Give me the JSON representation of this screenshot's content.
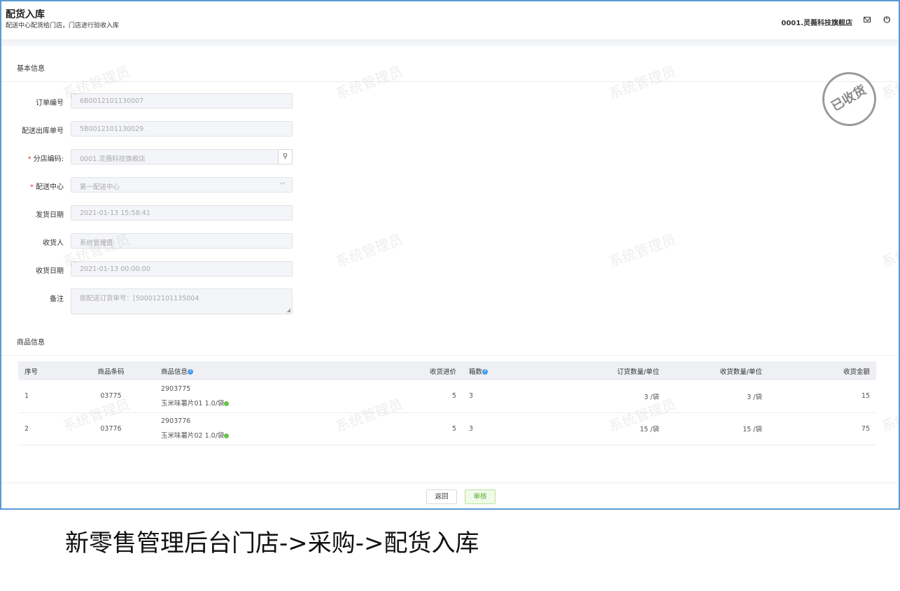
{
  "header": {
    "title": "配货入库",
    "subtitle": "配送中心配货给门店，门店进行验收入库",
    "store": "0001.灵薇科技旗舰店",
    "power_icon": "⏻"
  },
  "basic": {
    "section_title": "基本信息",
    "fields": [
      {
        "label": "订单编号",
        "value": "6B0012101130007"
      },
      {
        "label": "配送出库单号",
        "value": "5B0012101130029"
      },
      {
        "label": "分店编码:",
        "value": "0001.灵薇科技旗舰店",
        "required": "*"
      },
      {
        "label": "配送中心",
        "value": "第一配送中心",
        "required": "*"
      },
      {
        "label": "发货日期",
        "value": "2021-01-13 15:58:41"
      },
      {
        "label": "收货人",
        "value": "系统管理员"
      },
      {
        "label": "收货日期",
        "value": "2021-01-13 00:00:00"
      },
      {
        "label": "备注",
        "value": "原配送订货单号：[500012101135004"
      }
    ]
  },
  "stamp": "已收货",
  "watermark": "系统管理员",
  "goods": {
    "section_title": "商品信息",
    "columns": [
      "序号",
      "商品条码",
      "商品信息",
      "收货进价",
      "箱数",
      "订货数量/单位",
      "收货数量/单位",
      "收货金额"
    ],
    "rows": [
      {
        "no": "1",
        "barcode": "03775",
        "code": "2903775",
        "name": "玉米味薯片01 1.0/袋",
        "price": "5",
        "boxes": "3",
        "order_qty": "3 /袋",
        "recv_qty": "3 /袋",
        "amount": "15"
      },
      {
        "no": "2",
        "barcode": "03776",
        "code": "2903776",
        "name": "玉米味薯片02 1.0/袋",
        "price": "5",
        "boxes": "3",
        "order_qty": "15 /袋",
        "recv_qty": "15 /袋",
        "amount": "75"
      }
    ]
  },
  "footer": {
    "back": "返回",
    "approve": "审核"
  },
  "caption": "新零售管理后台门店->采购->配货入库",
  "colors": {
    "border": "#5b9bd5",
    "approve": "#52a82a",
    "help": "#4a9be8"
  }
}
